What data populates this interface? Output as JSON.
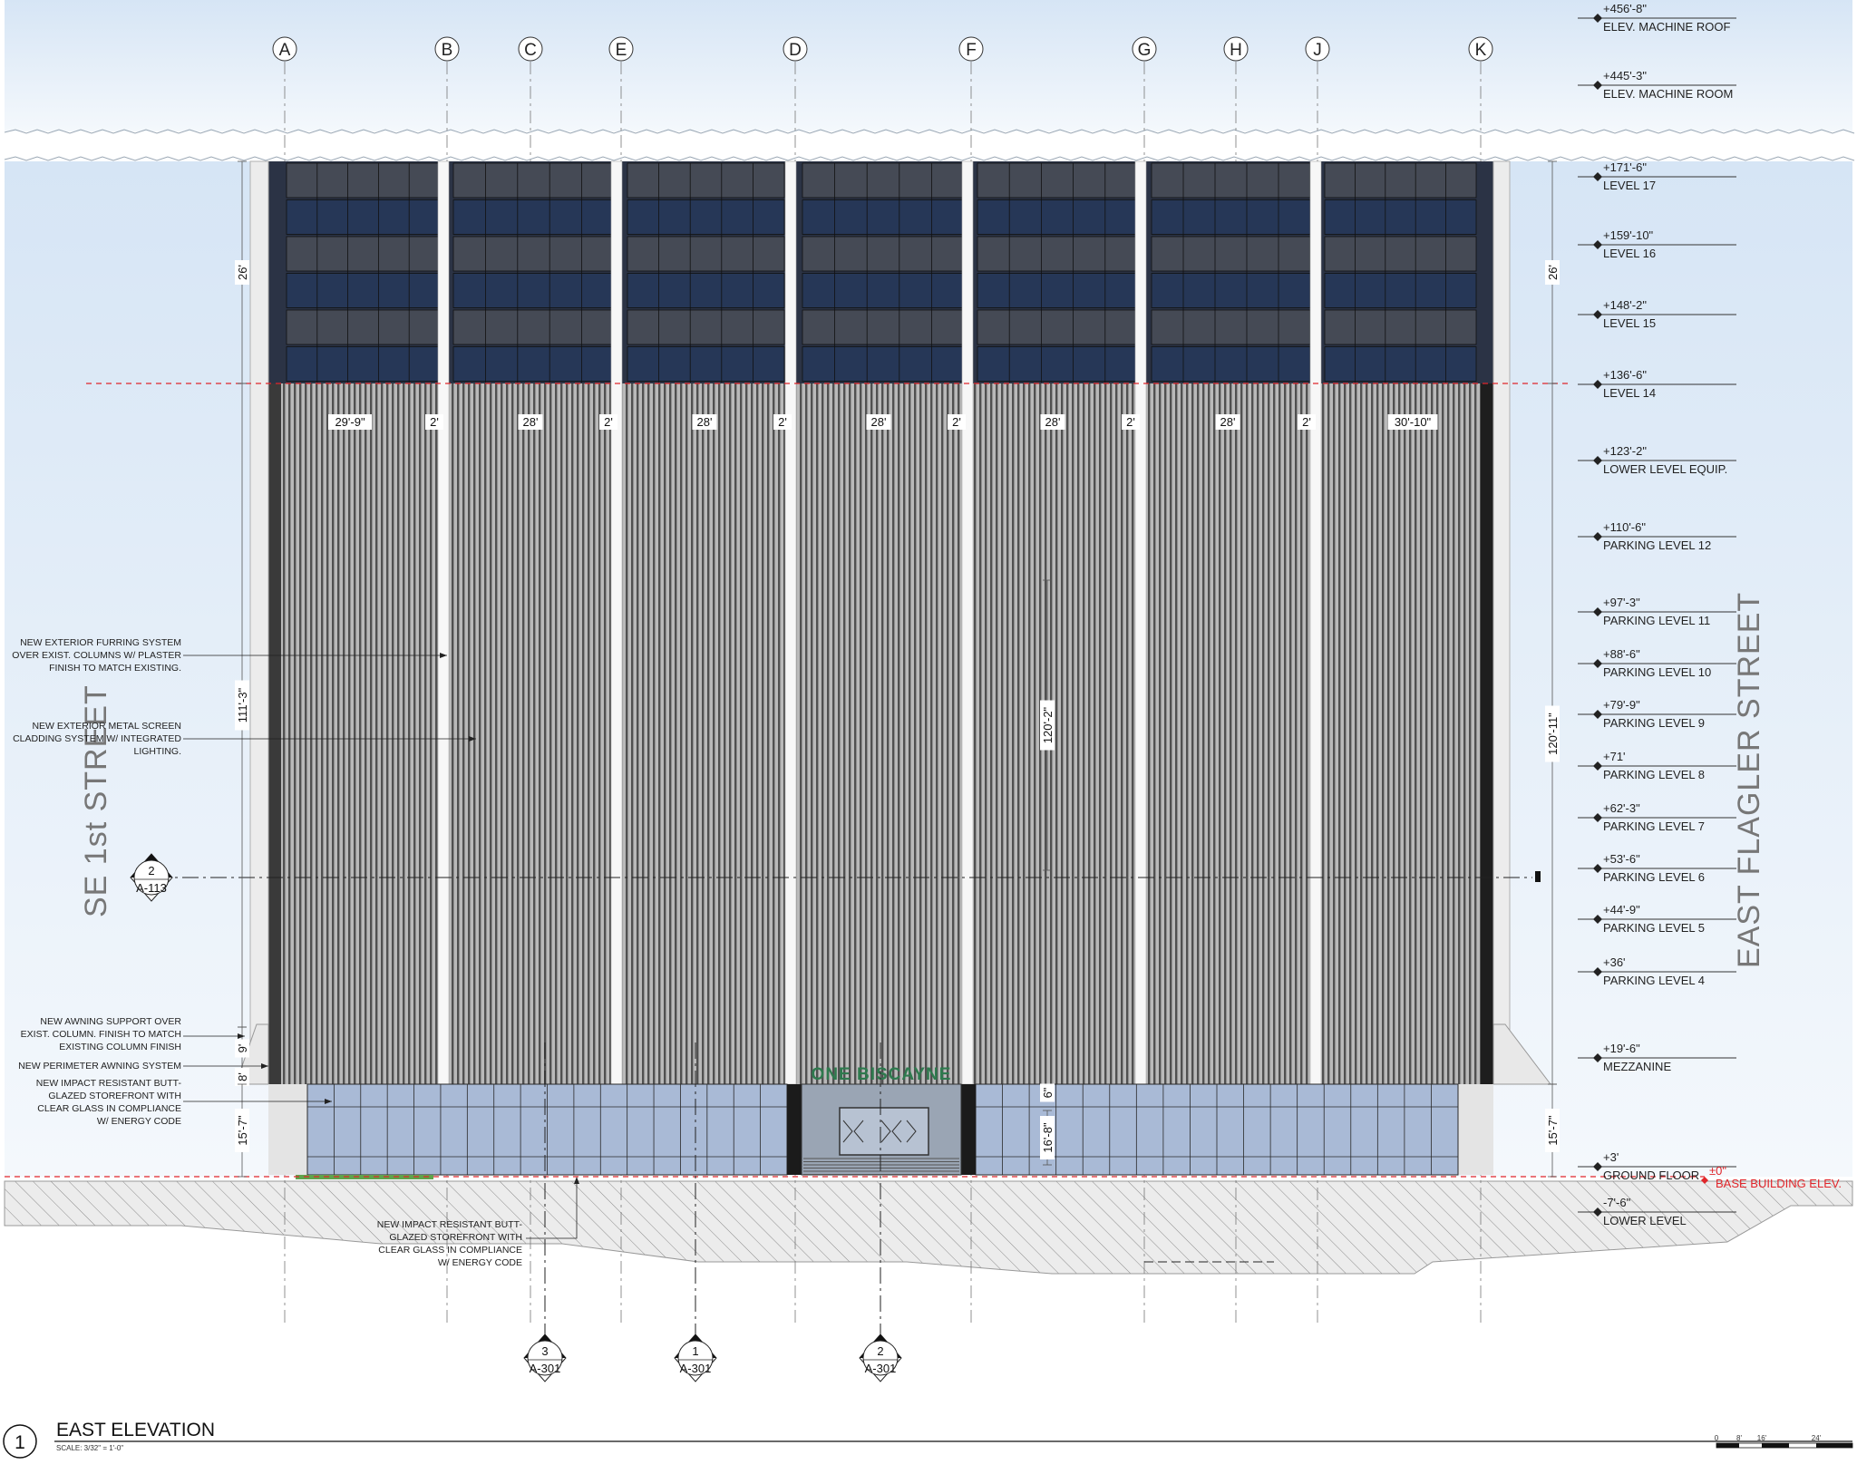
{
  "title": {
    "number": "1",
    "name": "EAST ELEVATION",
    "scale": "SCALE: 3/32\" = 1'-0\""
  },
  "streets": {
    "left": "SE 1st STREET",
    "right": "EAST FLAGLER STREET"
  },
  "grid_letters": [
    "A",
    "B",
    "C",
    "E",
    "D",
    "F",
    "G",
    "H",
    "J",
    "K"
  ],
  "levels": [
    {
      "elev": "+456'-8\"",
      "name": "ELEV. MACHINE ROOF"
    },
    {
      "elev": "+445'-3\"",
      "name": "ELEV. MACHINE ROOM"
    },
    {
      "elev": "+171'-6\"",
      "name": "LEVEL 17"
    },
    {
      "elev": "+159'-10\"",
      "name": "LEVEL 16"
    },
    {
      "elev": "+148'-2\"",
      "name": "LEVEL 15"
    },
    {
      "elev": "+136'-6\"",
      "name": "LEVEL 14"
    },
    {
      "elev": "+123'-2\"",
      "name": "LOWER LEVEL EQUIP."
    },
    {
      "elev": "+110'-6\"",
      "name": "PARKING LEVEL 12"
    },
    {
      "elev": "+97'-3\"",
      "name": "PARKING LEVEL 11"
    },
    {
      "elev": "+88'-6\"",
      "name": "PARKING LEVEL 10"
    },
    {
      "elev": "+79'-9\"",
      "name": "PARKING LEVEL 9"
    },
    {
      "elev": "+71'",
      "name": "PARKING LEVEL 8"
    },
    {
      "elev": "+62'-3\"",
      "name": "PARKING LEVEL 7"
    },
    {
      "elev": "+53'-6\"",
      "name": "PARKING LEVEL 6"
    },
    {
      "elev": "+44'-9\"",
      "name": "PARKING LEVEL 5"
    },
    {
      "elev": "+36'",
      "name": "PARKING LEVEL 4"
    },
    {
      "elev": "+19'-6\"",
      "name": "MEZZANINE"
    },
    {
      "elev": "+3'",
      "name": "GROUND FLOOR"
    },
    {
      "elev": "-7'-6\"",
      "name": "LOWER LEVEL"
    }
  ],
  "base_elev": {
    "elev": "±0\"",
    "name": "BASE BUILDING ELEV."
  },
  "bay_dims": [
    "29'-9\"",
    "2'",
    "28'",
    "2'",
    "28'",
    "2'",
    "28'",
    "2'",
    "28'",
    "2'",
    "28'",
    "2'",
    "30'-10\""
  ],
  "vertical_dims": {
    "left_26": "26'",
    "right_26": "26'",
    "left_111": "111'-3\"",
    "right_120": "120'-11\"",
    "center_120": "120'-2\"",
    "left_9": "9'",
    "left_8": "8'",
    "left_15": "15'-7\"",
    "right_15": "15'-7\"",
    "center_6": "6\"",
    "center_16": "16'-8\""
  },
  "notes": {
    "furring": [
      "NEW EXTERIOR FURRING SYSTEM",
      "OVER EXIST. COLUMNS W/ PLASTER",
      "FINISH TO MATCH EXISTING."
    ],
    "screen": [
      "NEW EXTERIOR METAL SCREEN",
      "CLADDING SYSTEM W/ INTEGRATED",
      "LIGHTING."
    ],
    "awning_support": [
      "NEW AWNING SUPPORT OVER",
      "EXIST. COLUMN. FINISH TO MATCH",
      "EXISTING COLUMN FINISH"
    ],
    "awning": [
      "NEW PERIMETER AWNING SYSTEM"
    ],
    "storefront_left": [
      "NEW IMPACT RESISTANT BUTT-",
      "GLAZED STOREFRONT WITH",
      "CLEAR GLASS IN COMPLIANCE",
      "W/ ENERGY CODE"
    ],
    "storefront_bottom": [
      "NEW IMPACT RESISTANT BUTT-",
      "GLAZED STOREFRONT WITH",
      "CLEAR GLASS IN COMPLIANCE",
      "W/ ENERGY CODE"
    ]
  },
  "section_markers": [
    {
      "num": "2",
      "sheet": "A-113"
    },
    {
      "num": "3",
      "sheet": "A-301"
    },
    {
      "num": "1",
      "sheet": "A-301"
    },
    {
      "num": "2",
      "sheet": "A-301"
    }
  ],
  "signage": "ONE BISCAYNE",
  "scale_bar": [
    "0",
    "8'",
    "16'",
    "24'"
  ],
  "colors": {
    "sky": "#dde9f6",
    "tower_glass": "#2a3244",
    "screen": "#8a8a8a",
    "storefront": "#a9bad6",
    "ground_hatch": "#d4d4d4",
    "level_red": "#e0262b"
  }
}
